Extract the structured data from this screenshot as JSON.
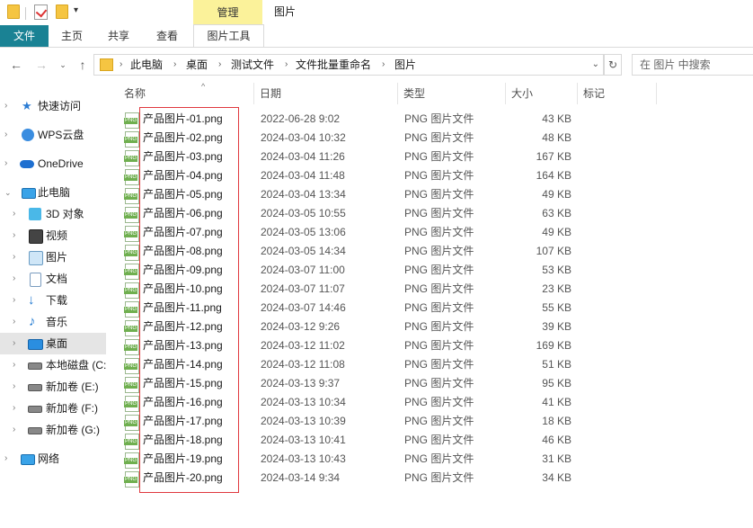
{
  "window": {
    "title": "图片",
    "contextual_tab_group": "管理"
  },
  "ribbon": {
    "tabs": [
      "文件",
      "主页",
      "共享",
      "查看",
      "图片工具"
    ]
  },
  "address": {
    "breadcrumbs": [
      "此电脑",
      "桌面",
      "测试文件",
      "文件批量重命名",
      "图片"
    ],
    "search_placeholder": "在 图片 中搜索"
  },
  "sidebar": {
    "items": [
      {
        "label": "快速访问",
        "icon": "star-icon"
      },
      {
        "label": "WPS云盘",
        "icon": "cloud-icon"
      },
      {
        "label": "OneDrive",
        "icon": "onedrive-icon"
      },
      {
        "label": "此电脑",
        "icon": "computer-icon"
      },
      {
        "label": "3D 对象",
        "icon": "cube-icon"
      },
      {
        "label": "视频",
        "icon": "video-icon"
      },
      {
        "label": "图片",
        "icon": "picture-icon"
      },
      {
        "label": "文档",
        "icon": "document-icon"
      },
      {
        "label": "下载",
        "icon": "download-icon"
      },
      {
        "label": "音乐",
        "icon": "music-icon"
      },
      {
        "label": "桌面",
        "icon": "desktop-icon"
      },
      {
        "label": "本地磁盘 (C:",
        "icon": "drive-icon"
      },
      {
        "label": "新加卷 (E:)",
        "icon": "drive-icon"
      },
      {
        "label": "新加卷 (F:)",
        "icon": "drive-icon"
      },
      {
        "label": "新加卷 (G:)",
        "icon": "drive-icon"
      },
      {
        "label": "网络",
        "icon": "network-icon"
      }
    ],
    "selected": "桌面"
  },
  "columns": [
    "名称",
    "日期",
    "类型",
    "大小",
    "标记"
  ],
  "files": [
    {
      "name": "产品图片-01.png",
      "date": "2022-06-28 9:02",
      "type": "PNG 图片文件",
      "size": "43 KB"
    },
    {
      "name": "产品图片-02.png",
      "date": "2024-03-04 10:32",
      "type": "PNG 图片文件",
      "size": "48 KB"
    },
    {
      "name": "产品图片-03.png",
      "date": "2024-03-04 11:26",
      "type": "PNG 图片文件",
      "size": "167 KB"
    },
    {
      "name": "产品图片-04.png",
      "date": "2024-03-04 11:48",
      "type": "PNG 图片文件",
      "size": "164 KB"
    },
    {
      "name": "产品图片-05.png",
      "date": "2024-03-04 13:34",
      "type": "PNG 图片文件",
      "size": "49 KB"
    },
    {
      "name": "产品图片-06.png",
      "date": "2024-03-05 10:55",
      "type": "PNG 图片文件",
      "size": "63 KB"
    },
    {
      "name": "产品图片-07.png",
      "date": "2024-03-05 13:06",
      "type": "PNG 图片文件",
      "size": "49 KB"
    },
    {
      "name": "产品图片-08.png",
      "date": "2024-03-05 14:34",
      "type": "PNG 图片文件",
      "size": "107 KB"
    },
    {
      "name": "产品图片-09.png",
      "date": "2024-03-07 11:00",
      "type": "PNG 图片文件",
      "size": "53 KB"
    },
    {
      "name": "产品图片-10.png",
      "date": "2024-03-07 11:07",
      "type": "PNG 图片文件",
      "size": "23 KB"
    },
    {
      "name": "产品图片-11.png",
      "date": "2024-03-07 14:46",
      "type": "PNG 图片文件",
      "size": "55 KB"
    },
    {
      "name": "产品图片-12.png",
      "date": "2024-03-12 9:26",
      "type": "PNG 图片文件",
      "size": "39 KB"
    },
    {
      "name": "产品图片-13.png",
      "date": "2024-03-12 11:02",
      "type": "PNG 图片文件",
      "size": "169 KB"
    },
    {
      "name": "产品图片-14.png",
      "date": "2024-03-12 11:08",
      "type": "PNG 图片文件",
      "size": "51 KB"
    },
    {
      "name": "产品图片-15.png",
      "date": "2024-03-13 9:37",
      "type": "PNG 图片文件",
      "size": "95 KB"
    },
    {
      "name": "产品图片-16.png",
      "date": "2024-03-13 10:34",
      "type": "PNG 图片文件",
      "size": "41 KB"
    },
    {
      "name": "产品图片-17.png",
      "date": "2024-03-13 10:39",
      "type": "PNG 图片文件",
      "size": "18 KB"
    },
    {
      "name": "产品图片-18.png",
      "date": "2024-03-13 10:41",
      "type": "PNG 图片文件",
      "size": "46 KB"
    },
    {
      "name": "产品图片-19.png",
      "date": "2024-03-13 10:43",
      "type": "PNG 图片文件",
      "size": "31 KB"
    },
    {
      "name": "产品图片-20.png",
      "date": "2024-03-14 9:34",
      "type": "PNG 图片文件",
      "size": "34 KB"
    }
  ],
  "file_icon_label": "PNG",
  "colors": {
    "file_tab": "#1a8294",
    "manage_tab": "#fbf29a",
    "highlight_box": "#e0383e",
    "selected_nav": "#e5e5e5"
  }
}
